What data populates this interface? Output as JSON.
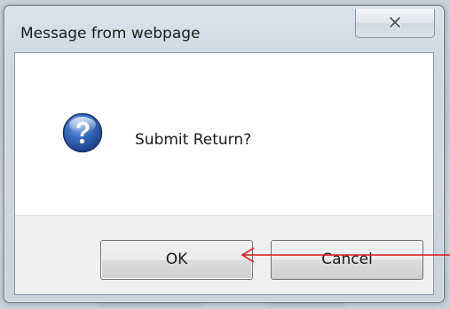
{
  "dialog": {
    "title": "Message from webpage",
    "message": "Submit Return?",
    "icon": "question-icon",
    "buttons": {
      "ok_label": "OK",
      "cancel_label": "Cancel"
    }
  },
  "colors": {
    "annotation_arrow": "#e0141c",
    "question_icon_blue": "#2a5fb0"
  }
}
